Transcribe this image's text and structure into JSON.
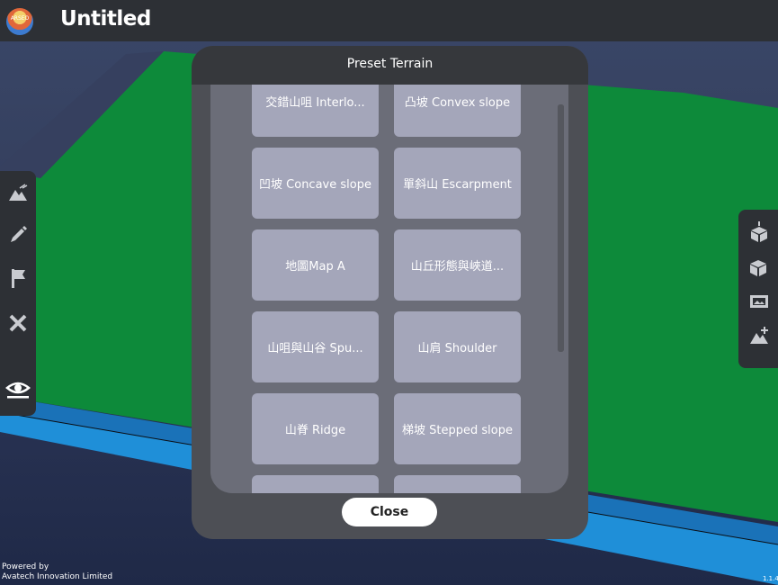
{
  "app": {
    "title": "Untitled",
    "logo_text": "ARSEO",
    "version": "1.1.4",
    "powered_by_line1": "Powered by",
    "powered_by_line2": "Avatech Innovation Limited"
  },
  "left_toolbar": {
    "items": [
      {
        "icon": "terrain-icon"
      },
      {
        "icon": "pencil-icon"
      },
      {
        "icon": "flag-icon"
      },
      {
        "icon": "tools-icon"
      },
      {
        "icon": "eye-icon"
      }
    ]
  },
  "right_toolbar": {
    "items": [
      {
        "icon": "cube-top-icon"
      },
      {
        "icon": "cube-rotate-icon"
      },
      {
        "icon": "image-card-icon"
      },
      {
        "icon": "terrain-add-icon"
      }
    ]
  },
  "modal": {
    "title": "Preset Terrain",
    "close_label": "Close",
    "tiles": [
      {
        "label": "交錯山咀 Interlo..."
      },
      {
        "label": "凸坡 Convex slope"
      },
      {
        "label": "凹坡 Concave slope"
      },
      {
        "label": "單斜山 Escarpment"
      },
      {
        "label": "地圖Map A"
      },
      {
        "label": "山丘形態與峽道..."
      },
      {
        "label": "山咀與山谷 Spu..."
      },
      {
        "label": "山肩 Shoulder"
      },
      {
        "label": "山脊 Ridge"
      },
      {
        "label": "梯坡 Stepped slope"
      },
      {
        "label": ""
      },
      {
        "label": ""
      }
    ]
  },
  "colors": {
    "terrain_green": "#0d8a3a",
    "water_blue": "#1f8fd8",
    "panel_dark": "#2d3035",
    "tile_bg": "#a4a6ba"
  }
}
